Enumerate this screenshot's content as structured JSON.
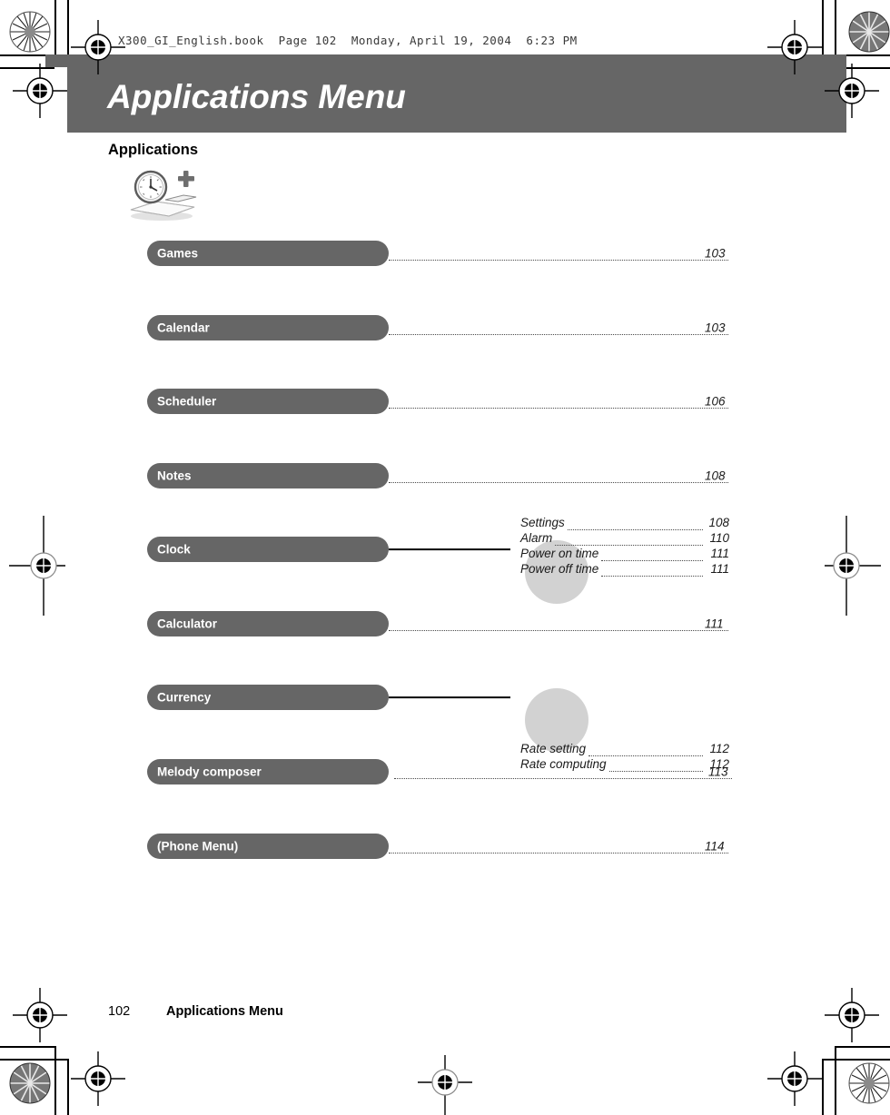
{
  "document": {
    "running_header": "X300_GI_English.book  Page 102  Monday, April 19, 2004  6:23 PM",
    "chapter_title": "Applications Menu",
    "section_heading": "Applications",
    "icon_name": "clock-calculator-icon",
    "footer_page_number": "102",
    "footer_title": "Applications Menu"
  },
  "colors": {
    "band_gray": "#666666",
    "pill_gray": "#666666",
    "blob_gray": "#d2d2d2",
    "text_black": "#1a1a1a",
    "text_white": "#ffffff"
  },
  "menu": [
    {
      "label": "Games",
      "page": "103",
      "connector": "dotted",
      "subitems": []
    },
    {
      "label": "Calendar",
      "page": "103",
      "connector": "dotted",
      "subitems": []
    },
    {
      "label": "Scheduler",
      "page": "106",
      "connector": "dotted",
      "subitems": []
    },
    {
      "label": "Notes",
      "page": "108",
      "connector": "dotted",
      "subitems": []
    },
    {
      "label": "Clock",
      "page": "",
      "connector": "solid",
      "subitems": [
        {
          "label": "Settings",
          "page": "108"
        },
        {
          "label": "Alarm",
          "page": "110"
        },
        {
          "label": "Power on time",
          "page": "111"
        },
        {
          "label": "Power off time",
          "page": "111"
        }
      ]
    },
    {
      "label": "Calculator",
      "page": "111",
      "connector": "dotted",
      "subitems": []
    },
    {
      "label": "Currency",
      "page": "",
      "connector": "solid",
      "subitems": [
        {
          "label": "Rate setting",
          "page": "112"
        },
        {
          "label": "Rate computing",
          "page": "112"
        }
      ]
    },
    {
      "label": "Melody composer",
      "page": "113",
      "connector": "dotted",
      "subitems": []
    },
    {
      "label": "(Phone Menu)",
      "page": "114",
      "connector": "dotted",
      "subitems": []
    }
  ]
}
